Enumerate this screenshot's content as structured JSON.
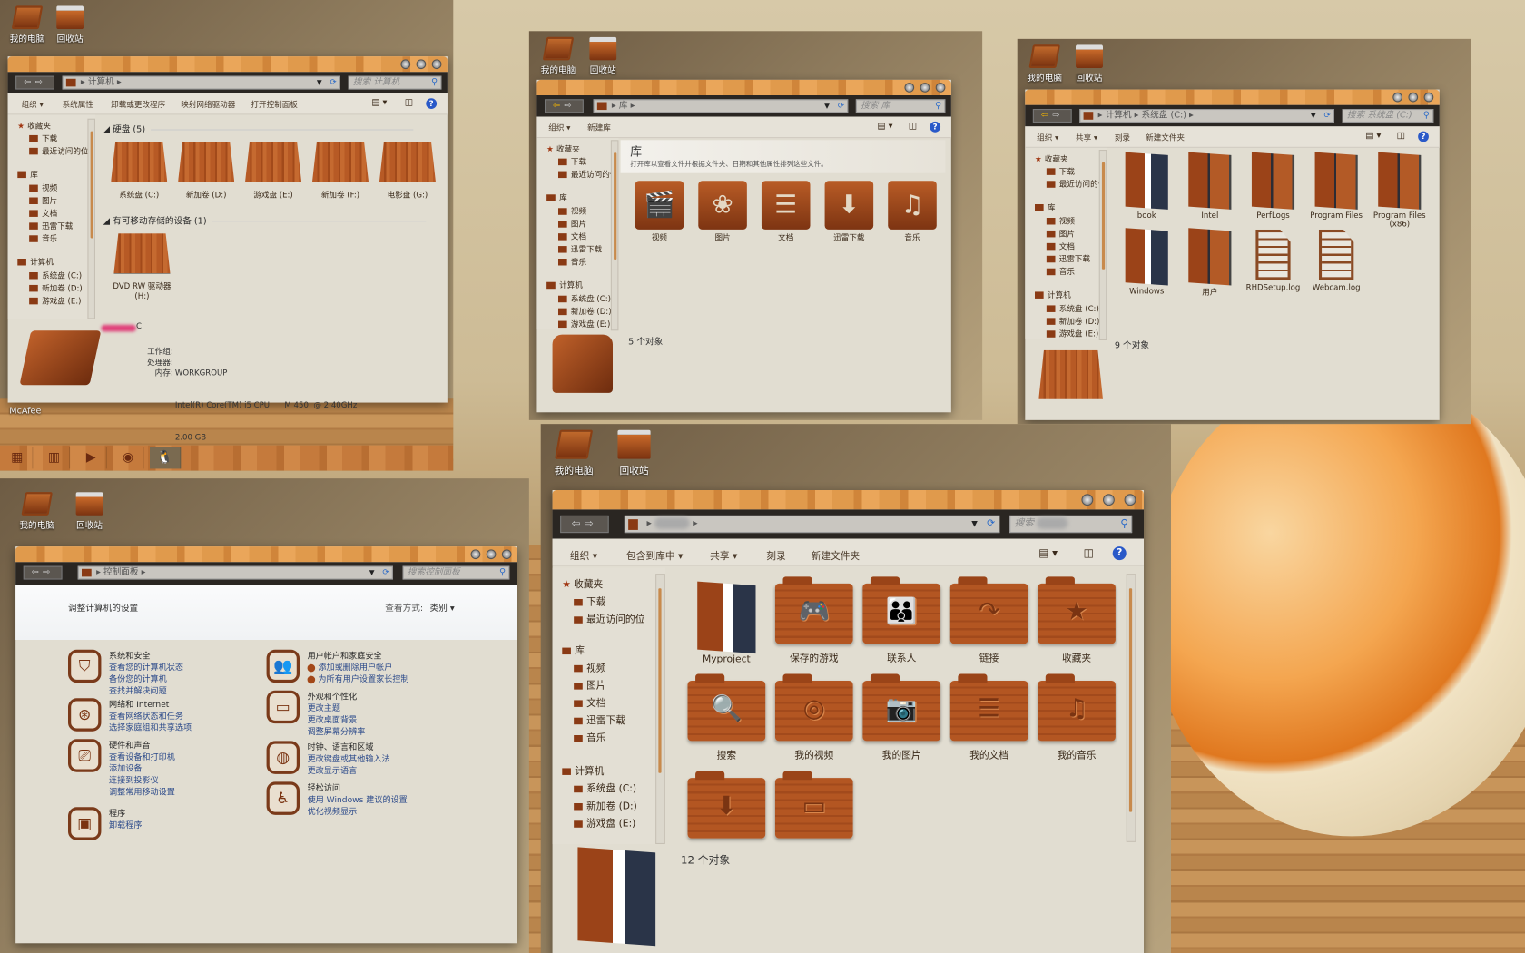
{
  "desktop": {
    "icons": [
      {
        "label": "我的电脑",
        "icon": "my-computer-icon"
      },
      {
        "label": "回收站",
        "icon": "recycle-bin-icon"
      }
    ],
    "mcafee_label": "McAfee",
    "taskbar": [
      {
        "icon": "start-orb-icon",
        "glyph": "▦"
      },
      {
        "icon": "library-icon",
        "glyph": "▥"
      },
      {
        "icon": "media-player-icon",
        "glyph": "▶"
      },
      {
        "icon": "disc-icon",
        "glyph": "◉"
      },
      {
        "icon": "qq-penguin-icon",
        "glyph": "🐧"
      }
    ]
  },
  "window_computer": {
    "address": [
      "计算机"
    ],
    "search_placeholder": "搜索 计算机",
    "commands": [
      "组织 ▾",
      "系统属性",
      "卸载或更改程序",
      "映射网络驱动器",
      "打开控制面板"
    ],
    "nav": [
      {
        "label": "收藏夹",
        "kind": "star"
      },
      {
        "label": "下载",
        "kind": "folder"
      },
      {
        "label": "最近访问的位",
        "kind": "folder"
      },
      {
        "label": "库",
        "kind": "library"
      },
      {
        "label": "视频",
        "kind": "folder"
      },
      {
        "label": "图片",
        "kind": "folder"
      },
      {
        "label": "文档",
        "kind": "folder"
      },
      {
        "label": "迅雷下载",
        "kind": "folder"
      },
      {
        "label": "音乐",
        "kind": "folder"
      },
      {
        "label": "计算机",
        "kind": "computer"
      },
      {
        "label": "系统盘 (C:)",
        "kind": "drive"
      },
      {
        "label": "新加卷 (D:)",
        "kind": "drive"
      },
      {
        "label": "游戏盘 (E:)",
        "kind": "drive"
      }
    ],
    "section_hdd": "硬盘 (5)",
    "drives": [
      "系统盘 (C:)",
      "新加卷 (D:)",
      "游戏盘 (E:)",
      "新加卷 (F:)",
      "电影盘 (G:)"
    ],
    "section_removable": "有可移动存储的设备 (1)",
    "removable": [
      "DVD RW 驱动器",
      "(H:)"
    ],
    "details": {
      "computer_name_suffix": "C",
      "workgroup_label": "工作组:",
      "workgroup": "WORKGROUP",
      "cpu_label": "处理器:",
      "cpu": "Intel(R) Core(TM) i5 CPU      M 450  @ 2.40GHz",
      "ram_label": "内存:",
      "ram": "2.00 GB"
    }
  },
  "window_library": {
    "address": [
      "库"
    ],
    "search_placeholder": "搜索 库",
    "commands": [
      "组织 ▾",
      "新建库"
    ],
    "nav": [
      {
        "label": "收藏夹"
      },
      {
        "label": "下载"
      },
      {
        "label": "最近访问的位"
      },
      {
        "label": "库"
      },
      {
        "label": "视频"
      },
      {
        "label": "图片"
      },
      {
        "label": "文档"
      },
      {
        "label": "迅雷下载"
      },
      {
        "label": "音乐"
      },
      {
        "label": "计算机"
      },
      {
        "label": "系统盘 (C:)"
      },
      {
        "label": "新加卷 (D:)"
      },
      {
        "label": "游戏盘 (E:)"
      }
    ],
    "header_title": "库",
    "header_desc": "打开库以查看文件并根据文件夹、日期和其他属性排列这些文件。",
    "items": [
      {
        "label": "视频",
        "glyph": "🎬"
      },
      {
        "label": "图片",
        "glyph": "❀"
      },
      {
        "label": "文档",
        "glyph": "☰"
      },
      {
        "label": "迅雷下载",
        "glyph": "⬇"
      },
      {
        "label": "音乐",
        "glyph": "♫"
      }
    ],
    "status": "5 个对象"
  },
  "window_cdrive": {
    "address": [
      "计算机",
      "系统盘 (C:)"
    ],
    "search_placeholder": "搜索 系统盘 (C:)",
    "commands": [
      "组织 ▾",
      "共享 ▾",
      "刻录",
      "新建文件夹"
    ],
    "nav": [
      {
        "label": "收藏夹"
      },
      {
        "label": "下载"
      },
      {
        "label": "最近访问的位"
      },
      {
        "label": "库"
      },
      {
        "label": "视频"
      },
      {
        "label": "图片"
      },
      {
        "label": "文档"
      },
      {
        "label": "迅雷下载"
      },
      {
        "label": "音乐"
      },
      {
        "label": "计算机"
      },
      {
        "label": "系统盘 (C:)"
      },
      {
        "label": "新加卷 (D:)"
      },
      {
        "label": "游戏盘 (E:)"
      }
    ],
    "items": [
      {
        "label": "book",
        "kind": "book-open"
      },
      {
        "label": "Intel",
        "kind": "book"
      },
      {
        "label": "PerfLogs",
        "kind": "book"
      },
      {
        "label": "Program Files",
        "kind": "book"
      },
      {
        "label": "Program Files (x86)",
        "kind": "book"
      },
      {
        "label": "Windows",
        "kind": "book-open"
      },
      {
        "label": "用户",
        "kind": "book"
      },
      {
        "label": "RHDSetup.log",
        "kind": "doc"
      },
      {
        "label": "Webcam.log",
        "kind": "doc"
      }
    ],
    "status": "9 个对象"
  },
  "window_control": {
    "address": [
      "控制面板"
    ],
    "search_placeholder": "搜索控制面板",
    "header": "调整计算机的设置",
    "view_label": "查看方式:",
    "view_value": "类别 ▾",
    "categories": [
      {
        "title": "系统和安全",
        "glyph": "⛉",
        "links": [
          "查看您的计算机状态",
          "备份您的计算机",
          "查找并解决问题"
        ]
      },
      {
        "title": "网络和 Internet",
        "glyph": "⊛",
        "links": [
          "查看网络状态和任务",
          "选择家庭组和共享选项"
        ]
      },
      {
        "title": "硬件和声音",
        "glyph": "⎚",
        "links": [
          "查看设备和打印机",
          "添加设备",
          "连接到投影仪",
          "调整常用移动设置"
        ]
      },
      {
        "title": "程序",
        "glyph": "▣",
        "links": [
          "卸载程序"
        ]
      },
      {
        "title": "用户帐户和家庭安全",
        "glyph": "👥",
        "links": [
          "添加或删除用户帐户",
          "为所有用户设置家长控制"
        ],
        "bullets": true
      },
      {
        "title": "外观和个性化",
        "glyph": "▭",
        "links": [
          "更改主题",
          "更改桌面背景",
          "调整屏幕分辨率"
        ]
      },
      {
        "title": "时钟、语言和区域",
        "glyph": "◍",
        "links": [
          "更改键盘或其他输入法",
          "更改显示语言"
        ]
      },
      {
        "title": "轻松访问",
        "glyph": "♿",
        "links": [
          "使用 Windows 建议的设置",
          "优化视频显示"
        ]
      }
    ]
  },
  "window_user": {
    "search_prefix": "搜索",
    "commands": [
      "组织 ▾",
      "包含到库中 ▾",
      "共享 ▾",
      "刻录",
      "新建文件夹"
    ],
    "nav": [
      {
        "label": "收藏夹"
      },
      {
        "label": "下载"
      },
      {
        "label": "最近访问的位"
      },
      {
        "label": "库"
      },
      {
        "label": "视频"
      },
      {
        "label": "图片"
      },
      {
        "label": "文档"
      },
      {
        "label": "迅雷下载"
      },
      {
        "label": "音乐"
      },
      {
        "label": "计算机"
      },
      {
        "label": "系统盘 (C:)"
      },
      {
        "label": "新加卷 (D:)"
      },
      {
        "label": "游戏盘 (E:)"
      }
    ],
    "items": [
      {
        "label": "Myproject",
        "glyph": "",
        "kind": "book-open"
      },
      {
        "label": "保存的游戏",
        "glyph": "🎮"
      },
      {
        "label": "联系人",
        "glyph": "👪"
      },
      {
        "label": "链接",
        "glyph": "↷"
      },
      {
        "label": "收藏夹",
        "glyph": "★"
      },
      {
        "label": "搜索",
        "glyph": "🔍"
      },
      {
        "label": "我的视频",
        "glyph": "◎"
      },
      {
        "label": "我的图片",
        "glyph": "📷"
      },
      {
        "label": "我的文档",
        "glyph": "☰"
      },
      {
        "label": "我的音乐",
        "glyph": "♫"
      },
      {
        "label": "",
        "glyph": "⬇"
      },
      {
        "label": "",
        "glyph": "▭"
      }
    ],
    "status": "12 个对象"
  }
}
